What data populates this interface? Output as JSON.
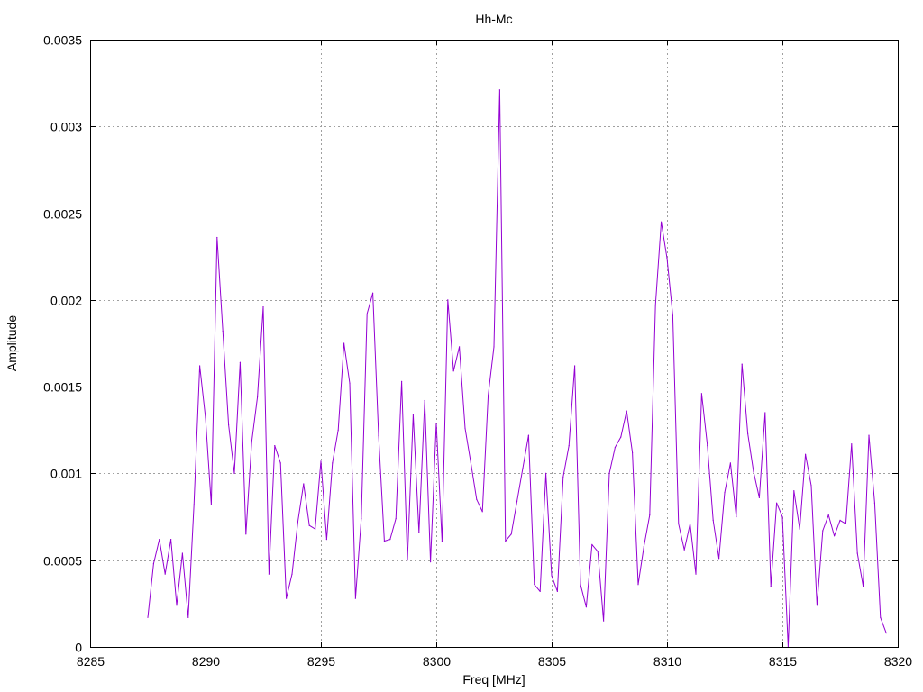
{
  "chart_data": {
    "type": "line",
    "title": "Hh-Mc",
    "xlabel": "Freq [MHz]",
    "ylabel": "Amplitude",
    "xlim": [
      8285,
      8320
    ],
    "ylim": [
      0,
      0.0035
    ],
    "x_ticks": [
      8285,
      8290,
      8295,
      8300,
      8305,
      8310,
      8315,
      8320
    ],
    "x_tick_labels": [
      "8285",
      "8290",
      "8295",
      "8300",
      "8305",
      "8310",
      "8315",
      "8320"
    ],
    "y_ticks": [
      0,
      0.0005,
      0.001,
      0.0015,
      0.002,
      0.0025,
      0.003,
      0.0035
    ],
    "y_tick_labels": [
      "0",
      "0.0005",
      "0.001",
      "0.0015",
      "0.002",
      "0.0025",
      "0.003",
      "0.0035"
    ],
    "grid": true,
    "line_color": "#9400d3",
    "series": [
      {
        "x": [
          8287.5,
          8287.75,
          8288.0,
          8288.25,
          8288.5,
          8288.75,
          8289.0,
          8289.25,
          8289.5,
          8289.75,
          8290.0,
          8290.25,
          8290.5,
          8290.75,
          8291.0,
          8291.25,
          8291.5,
          8291.75,
          8292.0,
          8292.25,
          8292.5,
          8292.75,
          8293.0,
          8293.25,
          8293.5,
          8293.75,
          8294.0,
          8294.25,
          8294.5,
          8294.75,
          8295.0,
          8295.25,
          8295.5,
          8295.75,
          8296.0,
          8296.25,
          8296.5,
          8296.75,
          8297.0,
          8297.25,
          8297.5,
          8297.75,
          8298.0,
          8298.25,
          8298.5,
          8298.75,
          8299.0,
          8299.25,
          8299.5,
          8299.75,
          8300.0,
          8300.25,
          8300.5,
          8300.75,
          8301.0,
          8301.25,
          8301.5,
          8301.75,
          8302.0,
          8302.25,
          8302.5,
          8302.75,
          8303.0,
          8303.25,
          8303.5,
          8303.75,
          8304.0,
          8304.25,
          8304.5,
          8304.75,
          8305.0,
          8305.25,
          8305.5,
          8305.75,
          8306.0,
          8306.25,
          8306.5,
          8306.75,
          8307.0,
          8307.25,
          8307.5,
          8307.75,
          8308.0,
          8308.25,
          8308.5,
          8308.75,
          8309.0,
          8309.25,
          8309.5,
          8309.75,
          8310.0,
          8310.25,
          8310.5,
          8310.75,
          8311.0,
          8311.25,
          8311.5,
          8311.75,
          8312.0,
          8312.25,
          8312.5,
          8312.75,
          8313.0,
          8313.25,
          8313.5,
          8313.75,
          8314.0,
          8314.25,
          8314.5,
          8314.75,
          8315.0,
          8315.25,
          8315.5,
          8315.75,
          8316.0,
          8316.25,
          8316.5,
          8316.75,
          8317.0,
          8317.25,
          8317.5,
          8317.75,
          8318.0,
          8318.25,
          8318.5,
          8318.75,
          8319.0,
          8319.25,
          8319.5
        ],
        "values": [
          0.00017,
          0.00048,
          0.00062,
          0.00042,
          0.00062,
          0.00024,
          0.00054,
          0.00017,
          0.00082,
          0.00162,
          0.00132,
          0.00082,
          0.00236,
          0.00182,
          0.00128,
          0.001,
          0.00164,
          0.00065,
          0.00118,
          0.00144,
          0.00196,
          0.00042,
          0.00116,
          0.00106,
          0.00028,
          0.00042,
          0.00072,
          0.00094,
          0.0007,
          0.00068,
          0.00107,
          0.00062,
          0.00106,
          0.00125,
          0.00175,
          0.00152,
          0.00028,
          0.00074,
          0.00192,
          0.00204,
          0.00122,
          0.00061,
          0.00062,
          0.00074,
          0.00153,
          0.0005,
          0.00134,
          0.00066,
          0.00142,
          0.00049,
          0.00129,
          0.00061,
          0.002,
          0.00159,
          0.00173,
          0.00126,
          0.00106,
          0.00085,
          0.00078,
          0.00145,
          0.00173,
          0.00321,
          0.00061,
          0.00065,
          0.00084,
          0.00103,
          0.00122,
          0.00036,
          0.00032,
          0.001,
          0.00041,
          0.00032,
          0.00098,
          0.00116,
          0.00162,
          0.00036,
          0.00023,
          0.00059,
          0.00055,
          0.00015,
          0.001,
          0.00115,
          0.00121,
          0.00136,
          0.00112,
          0.00036,
          0.00058,
          0.00076,
          0.00197,
          0.00245,
          0.00224,
          0.00191,
          0.00071,
          0.00056,
          0.00071,
          0.00042,
          0.00146,
          0.00116,
          0.00073,
          0.00051,
          0.00089,
          0.00106,
          0.00075,
          0.00163,
          0.00123,
          0.00101,
          0.00086,
          0.00135,
          0.00035,
          0.00083,
          0.00075,
          0.0,
          0.0009,
          0.00068,
          0.00111,
          0.00093,
          0.00024,
          0.00067,
          0.00076,
          0.00064,
          0.00073,
          0.00071,
          0.00117,
          0.00054,
          0.00035,
          0.00122,
          0.00083,
          0.00017,
          8e-05
        ]
      }
    ]
  }
}
